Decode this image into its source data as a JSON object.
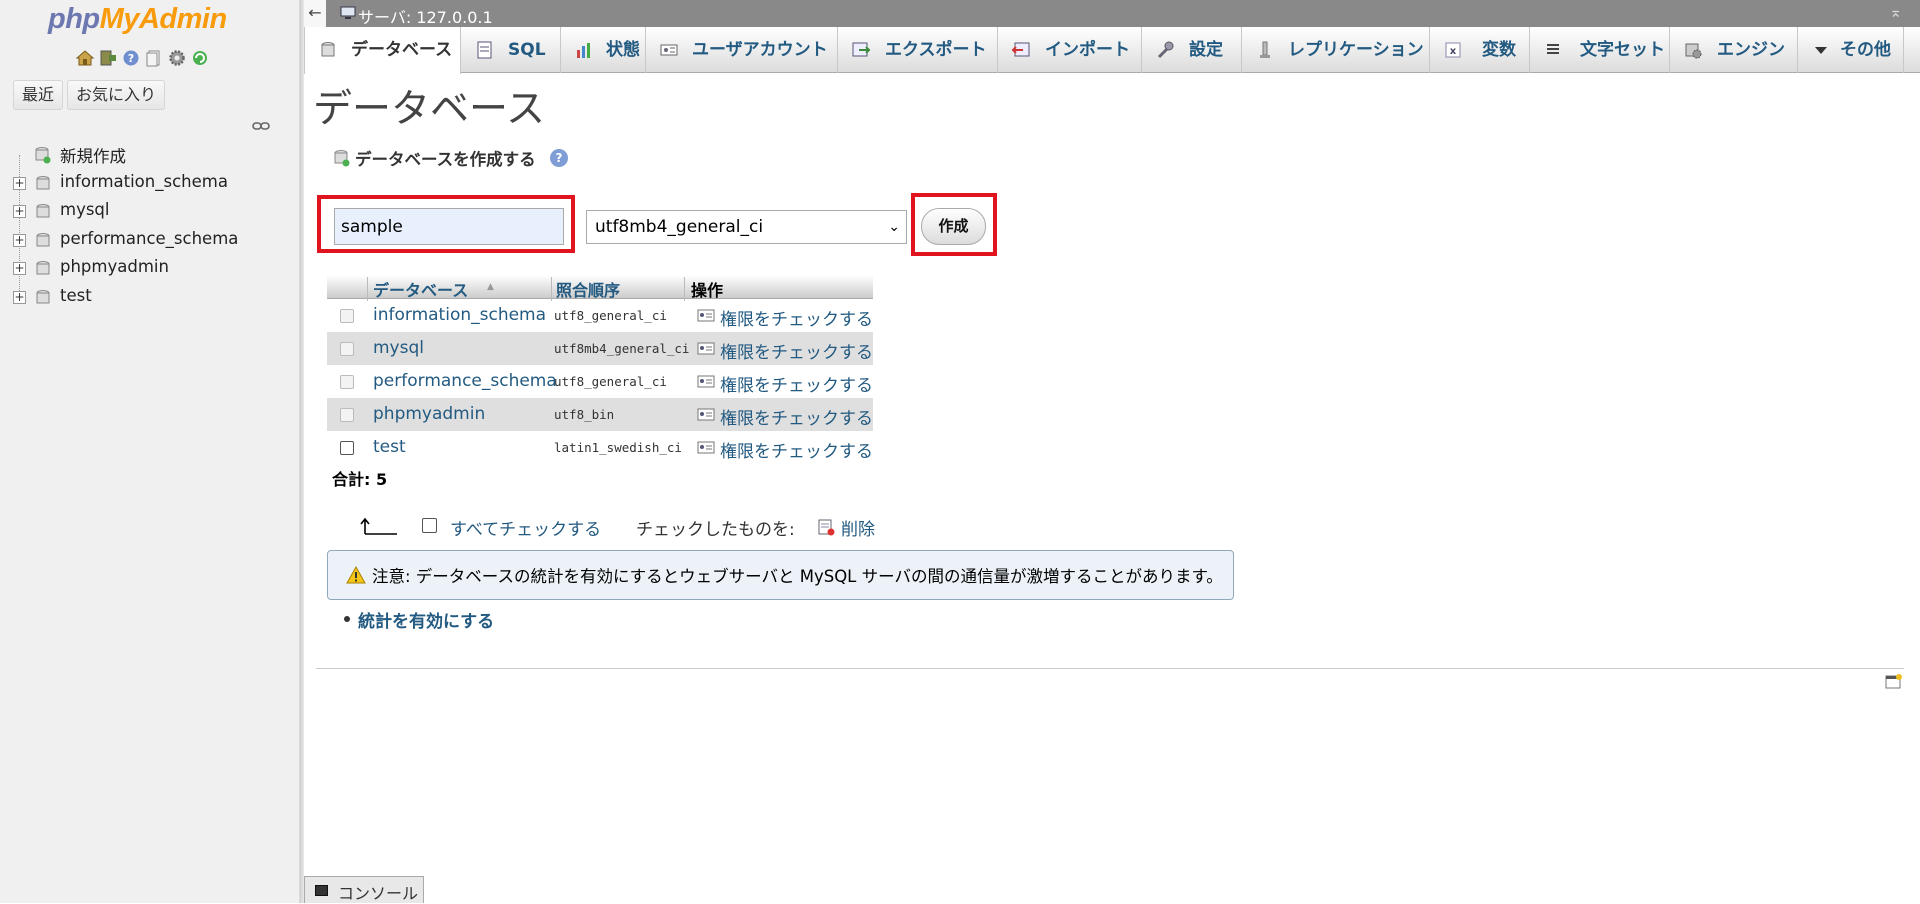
{
  "sidebar": {
    "logo_php": "php",
    "logo_admin": "MyAdmin",
    "tabs": [
      "最近",
      "お気に入り"
    ],
    "tree": [
      {
        "label": "新規作成",
        "type": "new"
      },
      {
        "label": "information_schema",
        "type": "db"
      },
      {
        "label": "mysql",
        "type": "db"
      },
      {
        "label": "performance_schema",
        "type": "db"
      },
      {
        "label": "phpmyadmin",
        "type": "db"
      },
      {
        "label": "test",
        "type": "db"
      }
    ]
  },
  "topbar": {
    "server_label": "サーバ:  127.0.0.1",
    "back_glyph": "←",
    "collapse_glyph": "⌅"
  },
  "menu": [
    {
      "label": "データベース",
      "icon": "database-icon",
      "active": true
    },
    {
      "label": "SQL",
      "icon": "sql-icon"
    },
    {
      "label": "状態",
      "icon": "status-chart-icon"
    },
    {
      "label": "ユーザアカウント",
      "icon": "user-accounts-icon"
    },
    {
      "label": "エクスポート",
      "icon": "export-icon"
    },
    {
      "label": "インポート",
      "icon": "import-icon"
    },
    {
      "label": "設定",
      "icon": "wrench-icon"
    },
    {
      "label": "レプリケーション",
      "icon": "replication-icon"
    },
    {
      "label": "変数",
      "icon": "variables-icon"
    },
    {
      "label": "文字セット",
      "icon": "charset-icon"
    },
    {
      "label": "エンジン",
      "icon": "engine-icon"
    },
    {
      "label": "その他",
      "icon": "chevron-down-icon"
    }
  ],
  "main": {
    "title": "データベース",
    "create": {
      "heading": "データベースを作成する",
      "name_value": "sample",
      "collation_value": "utf8mb4_general_ci",
      "button_label": "作成"
    },
    "table": {
      "headers": {
        "database": "データベース",
        "collation": "照合順序",
        "action": "操作"
      },
      "rows": [
        {
          "name": "information_schema",
          "collation": "utf8_general_ci",
          "action": "権限をチェックする"
        },
        {
          "name": "mysql",
          "collation": "utf8mb4_general_ci",
          "action": "権限をチェックする"
        },
        {
          "name": "performance_schema",
          "collation": "utf8_general_ci",
          "action": "権限をチェックする"
        },
        {
          "name": "phpmyadmin",
          "collation": "utf8_bin",
          "action": "権限をチェックする"
        },
        {
          "name": "test",
          "collation": "latin1_swedish_ci",
          "action": "権限をチェックする"
        }
      ],
      "total": "合計: 5"
    },
    "check_all_label": "すべてチェックする",
    "with_checked_label": "チェックしたものを:",
    "delete_label": "削除",
    "notice": "注意: データベースの統計を有効にするとウェブサーバと MySQL サーバの間の通信量が激増することがあります。",
    "enable_stats_label": "統計を有効にする"
  },
  "console_label": "コンソール",
  "colors": {
    "link": "#235a81",
    "highlight_box": "#e0141e",
    "notice_bg": "#ecf2f7"
  }
}
